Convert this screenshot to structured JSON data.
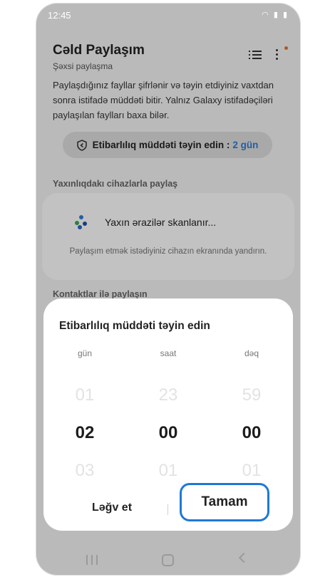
{
  "status_bar": {
    "time": "12:45",
    "icons": "wifi-icon signal-icon battery-icon"
  },
  "header": {
    "title": "Cəld Paylaşım",
    "subtitle": "Şəxsi paylaşma"
  },
  "description": "Paylaşdığınız fayllar şifrlənir və təyin etdiyiniz vaxtdan sonra istifadə müddəti bitir. Yalnız Galaxy istifadəçiləri paylaşılan faylları baxa bilər.",
  "expiration": {
    "label": "Etibarlılıq müddəti təyin edin :",
    "value": "2 gün"
  },
  "nearby": {
    "section_label": "Yaxınlıqdakı cihazlarla paylaş",
    "scanning_text": "Yaxın ərazilər skanlanır...",
    "hint": "Paylaşım etmək istədiyiniz cihazın ekranında yandırın."
  },
  "contacts": {
    "section_label": "Kontaktlar ilə paylaşın"
  },
  "dialog": {
    "title": "Etibarlılıq müddəti təyin edin",
    "columns": [
      {
        "label": "gün",
        "prev": "01",
        "selected": "02",
        "next": "03"
      },
      {
        "label": "saat",
        "prev": "23",
        "selected": "00",
        "next": "01"
      },
      {
        "label": "dəq",
        "prev": "59",
        "selected": "00",
        "next": "01"
      }
    ],
    "cancel_label": "Ləğv et",
    "ok_label": "Tamam"
  },
  "colors": {
    "accent": "#1f78d6",
    "value_blue": "#2f7bd8",
    "notification": "#e8742f"
  }
}
